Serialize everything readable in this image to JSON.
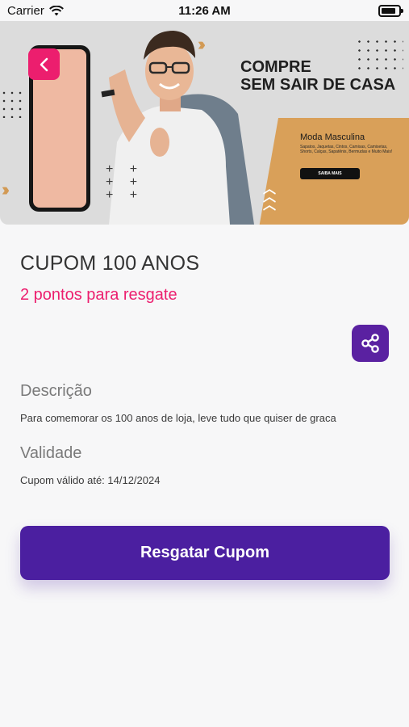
{
  "status_bar": {
    "carrier": "Carrier",
    "time": "11:26 AM"
  },
  "banner": {
    "headline_line1": "COMPRE",
    "headline_line2": "SEM SAIR DE CASA",
    "category_title": "Moda Masculina",
    "category_desc": "Sapatos, Jaquetas, Cintos, Camisas, Camisetas, Shorts, Calças, Sapatênis, Bermudas e Muito Mais!",
    "cta_small": "SAIBA MAIS"
  },
  "coupon": {
    "title": "CUPOM 100 ANOS",
    "points": "2 pontos para resgate"
  },
  "description": {
    "heading": "Descrição",
    "text": "Para comemorar os 100 anos de loja, leve tudo que quiser de graca"
  },
  "validity": {
    "heading": "Validade",
    "text": "Cupom válido até: 14/12/2024"
  },
  "actions": {
    "redeem_label": "Resgatar Cupom"
  },
  "colors": {
    "accent_pink": "#ec1e6e",
    "primary_purple": "#4b1fa0",
    "share_purple": "#5a21a1"
  }
}
